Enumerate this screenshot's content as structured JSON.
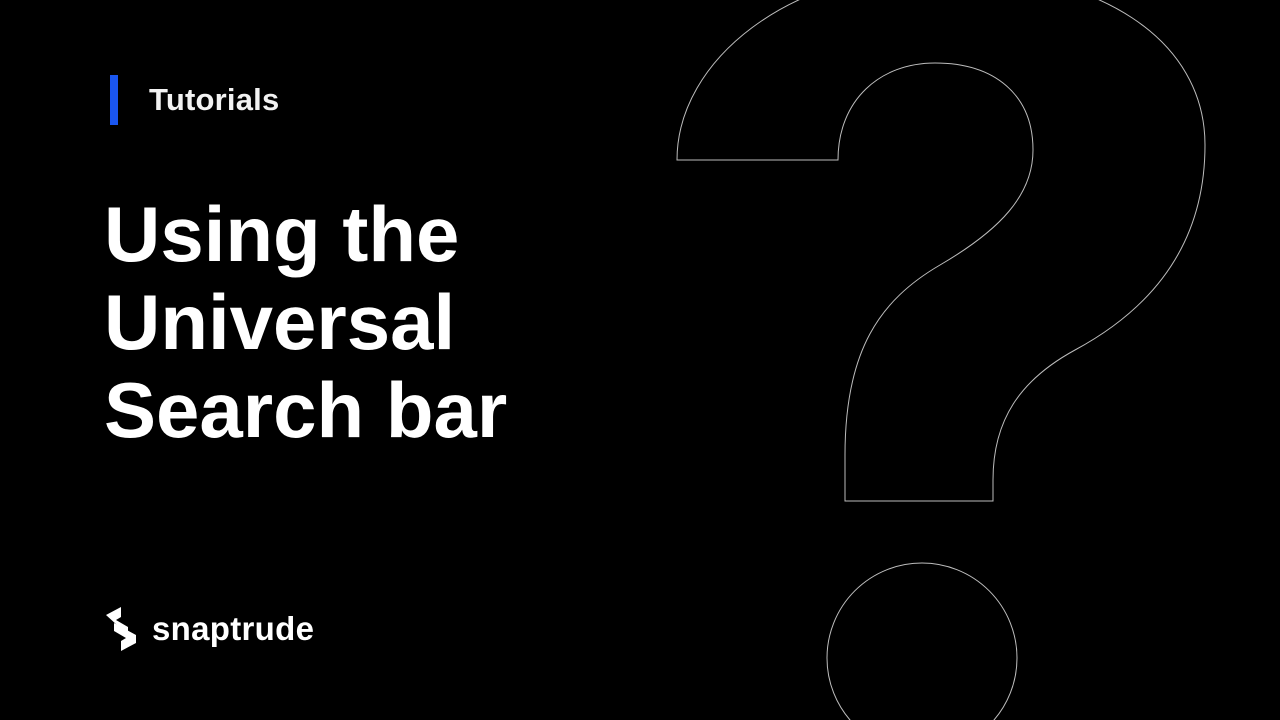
{
  "category": {
    "label": "Tutorials",
    "accent_color": "#1a56f0"
  },
  "title": {
    "lines": [
      "Using the",
      "Universal",
      "Search bar"
    ]
  },
  "brand": {
    "name": "snaptrude",
    "icon": "snaptrude-logo-icon"
  },
  "decoration": {
    "icon": "question-mark-outline-icon",
    "stroke_color": "#bdbdbd"
  }
}
